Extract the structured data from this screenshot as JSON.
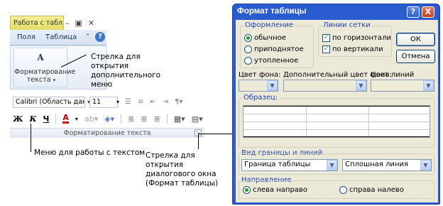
{
  "ribbon": {
    "context_tab": "Работа с табл...",
    "tabs": [
      "Поля",
      "Таблица"
    ],
    "format_button": [
      "Форматирование",
      "текста"
    ],
    "format_caret": "▾"
  },
  "toolbar": {
    "font": "Calibri (Область данны",
    "size": "11",
    "bold": "Ж",
    "italic": "К",
    "underline": "Ч",
    "font_color": "A",
    "caption": "Форматирование текста"
  },
  "annotations": {
    "submenu_arrow": "Стрелка для открытия дополнительного меню",
    "text_menu": "Меню для работы с текстом",
    "dialog_arrow": "Стрелка для открытия диалогового окна (Формат таблицы)"
  },
  "dialog": {
    "title": "Формат таблицы",
    "help": "?",
    "close": "X",
    "appearance": {
      "label": "Оформление",
      "options": [
        "обычное",
        "приподнятое",
        "утопленное"
      ],
      "selected": 0
    },
    "gridlines": {
      "label": "Линии сетки",
      "horizontal": "по горизонтали",
      "vertical": "по вертикали",
      "horizontal_checked": true,
      "vertical_checked": true
    },
    "ok": "ОК",
    "cancel": "Отмена",
    "bg_color_label": "Цвет фона:",
    "alt_bg_color_label": "Дополнительный цвет фона:",
    "gridline_color_label": "Цвет линий сетки:",
    "sample_label": "Образец:",
    "border_group_label": "Вид границы и линий",
    "border_value": "Граница таблицы",
    "line_value": "Сплошная линия",
    "direction_group_label": "Направление",
    "direction_ltr": "слева направо",
    "direction_rtl": "справа налево",
    "direction_selected": "ltr",
    "gridline_color": "#f1ecd8",
    "title_bar_color": "#2a5ccf"
  }
}
